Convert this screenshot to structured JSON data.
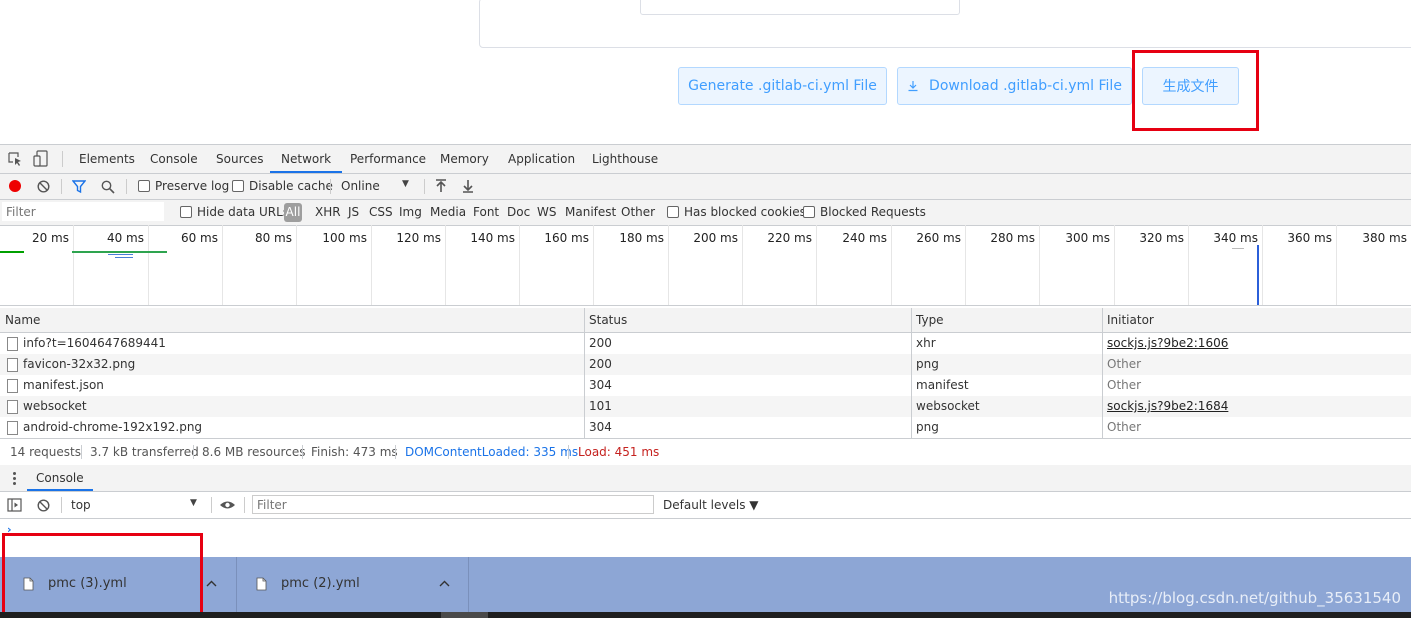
{
  "page": {
    "buttons": {
      "generate": "Generate .gitlab-ci.yml File",
      "download": "Download .gitlab-ci.yml File",
      "create_file": "生成文件"
    },
    "download_icon": "download-arrow-icon"
  },
  "devtools": {
    "tabs": [
      "Elements",
      "Console",
      "Sources",
      "Network",
      "Performance",
      "Memory",
      "Application",
      "Lighthouse"
    ],
    "active_tab": "Network",
    "toolbar": {
      "preserve_log": "Preserve log",
      "disable_cache": "Disable cache",
      "throttle": "Online"
    },
    "filter_bar": {
      "placeholder": "Filter",
      "hide_data_urls": "Hide data URLs",
      "types": [
        "All",
        "XHR",
        "JS",
        "CSS",
        "Img",
        "Media",
        "Font",
        "Doc",
        "WS",
        "Manifest",
        "Other"
      ],
      "has_blocked_cookies": "Has blocked cookies",
      "blocked_requests": "Blocked Requests"
    },
    "timeline_ticks": [
      "20 ms",
      "40 ms",
      "60 ms",
      "80 ms",
      "100 ms",
      "120 ms",
      "140 ms",
      "160 ms",
      "180 ms",
      "200 ms",
      "220 ms",
      "240 ms",
      "260 ms",
      "280 ms",
      "300 ms",
      "320 ms",
      "340 ms",
      "360 ms",
      "380 ms"
    ],
    "table": {
      "headers": [
        "Name",
        "Status",
        "Type",
        "Initiator"
      ],
      "rows": [
        {
          "name": "info?t=1604647689441",
          "status": "200",
          "type": "xhr",
          "initiator": "sockjs.js?9be2:1606",
          "initiator_link": true
        },
        {
          "name": "favicon-32x32.png",
          "status": "200",
          "type": "png",
          "initiator": "Other",
          "initiator_link": false
        },
        {
          "name": "manifest.json",
          "status": "304",
          "type": "manifest",
          "initiator": "Other",
          "initiator_link": false
        },
        {
          "name": "websocket",
          "status": "101",
          "type": "websocket",
          "initiator": "sockjs.js?9be2:1684",
          "initiator_link": true
        },
        {
          "name": "android-chrome-192x192.png",
          "status": "304",
          "type": "png",
          "initiator": "Other",
          "initiator_link": false
        }
      ]
    },
    "summary": {
      "requests": "14 requests",
      "transferred": "3.7 kB transferred",
      "resources": "8.6 MB resources",
      "finish": "Finish: 473 ms",
      "dom_loaded": "DOMContentLoaded: 335 ms",
      "load": "Load: 451 ms"
    },
    "drawer": {
      "tab": "Console",
      "context": "top",
      "filter_placeholder": "Filter",
      "levels": "Default levels ▼"
    }
  },
  "downloads": [
    {
      "filename": "pmc (3).yml"
    },
    {
      "filename": "pmc (2).yml"
    }
  ],
  "watermark": "https://blog.csdn.net/github_35631540",
  "colors": {
    "accent": "#1a73e8",
    "button_bg": "#ecf5ff",
    "button_text": "#409eff",
    "highlight_box": "#e60012",
    "download_bar": "#8da6d5",
    "load_red": "#c5221f"
  }
}
